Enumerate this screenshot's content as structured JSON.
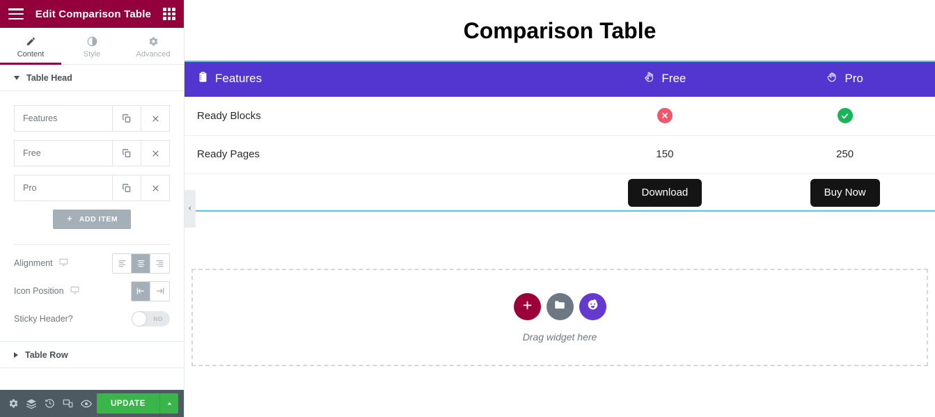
{
  "panel": {
    "header": {
      "title": "Edit Comparison Table",
      "menu_icon": "hamburger-icon",
      "apps_icon": "grid-apps-icon"
    },
    "tabs": [
      {
        "label": "Content",
        "icon": "pencil-icon",
        "active": true
      },
      {
        "label": "Style",
        "icon": "contrast-circle-icon",
        "active": false
      },
      {
        "label": "Advanced",
        "icon": "gear-icon",
        "active": false
      }
    ],
    "sections": [
      {
        "title": "Table Head",
        "expanded": true
      },
      {
        "title": "Table Row",
        "expanded": false
      }
    ],
    "repeater": {
      "items": [
        {
          "label": "Features",
          "duplicate_icon": "copy-icon",
          "remove_icon": "close-icon"
        },
        {
          "label": "Free",
          "duplicate_icon": "copy-icon",
          "remove_icon": "close-icon"
        },
        {
          "label": "Pro",
          "duplicate_icon": "copy-icon",
          "remove_icon": "close-icon"
        }
      ],
      "add_item_label": "ADD ITEM",
      "add_item_icon": "plus-icon"
    },
    "controls": [
      {
        "label": "Alignment",
        "device_icon": "desktop-icon",
        "options": [
          "align-left",
          "align-center",
          "align-right"
        ],
        "selected_index": 1
      },
      {
        "label": "Icon Position",
        "device_icon": "desktop-icon",
        "options": [
          "icon-before",
          "icon-after"
        ],
        "selected_index": 0
      },
      {
        "label": "Sticky Header?",
        "type": "switcher",
        "value": "NO"
      }
    ],
    "footer": {
      "icons": [
        "settings-gear-icon",
        "navigator-layers-icon",
        "history-icon",
        "responsive-mode-icon",
        "preview-eye-icon"
      ],
      "update_label": "UPDATE",
      "update_caret_icon": "chevron-up-icon"
    },
    "collapse_handle_icon": "chevron-left-icon"
  },
  "canvas": {
    "page_title": "Comparison Table",
    "table": {
      "header": [
        {
          "label": "Features",
          "icon": "clipboard-list-icon",
          "align": "left"
        },
        {
          "label": "Free",
          "icon": "pointing-hand-icon",
          "align": "center"
        },
        {
          "label": "Pro",
          "icon": "raised-hand-icon",
          "align": "center"
        }
      ],
      "rows": [
        {
          "feature": "Ready Blocks",
          "free": {
            "type": "icon",
            "icon": "x-circle-icon",
            "color": "#f0566a"
          },
          "pro": {
            "type": "icon",
            "icon": "check-circle-icon",
            "color": "#18b457"
          }
        },
        {
          "feature": "Ready Pages",
          "free": {
            "type": "text",
            "value": "150"
          },
          "pro": {
            "type": "text",
            "value": "250"
          }
        }
      ],
      "footer_buttons": [
        {
          "label": "Download"
        },
        {
          "label": "Buy Now"
        }
      ],
      "header_bg": "#5335d0",
      "selection_color": "#59c5ee"
    },
    "dropzone": {
      "text": "Drag widget here",
      "buttons": [
        {
          "icon": "plus-icon",
          "color": "#9b0039"
        },
        {
          "icon": "folder-icon",
          "color": "#6d7882"
        },
        {
          "icon": "happy-face-icon",
          "color": "#6439d0"
        }
      ]
    }
  },
  "theme": {
    "brand": "#93003c",
    "accent_purple": "#5335d0",
    "update_green": "#39b54a",
    "selection_blue": "#59c5ee"
  }
}
